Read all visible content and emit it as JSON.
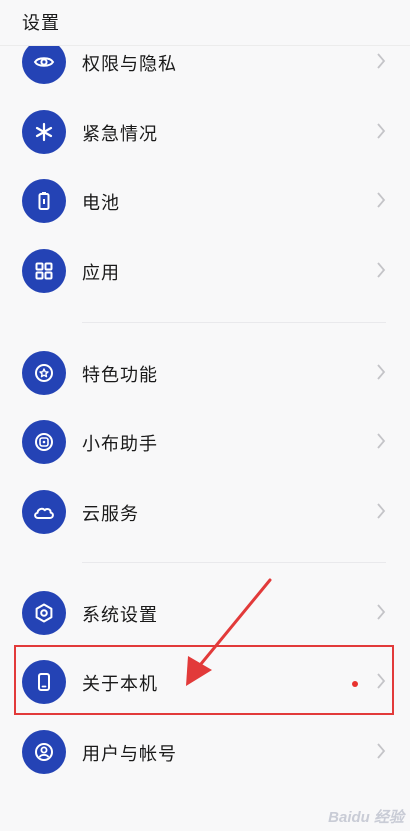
{
  "header": {
    "title": "设置"
  },
  "items": [
    {
      "label": "权限与隐私",
      "icon": "privacy-eye-icon"
    },
    {
      "label": "紧急情况",
      "icon": "emergency-asterisk-icon"
    },
    {
      "label": "电池",
      "icon": "battery-icon"
    },
    {
      "label": "应用",
      "icon": "apps-grid-icon"
    },
    {
      "label": "特色功能",
      "icon": "star-badge-icon"
    },
    {
      "label": "小布助手",
      "icon": "assistant-icon"
    },
    {
      "label": "云服务",
      "icon": "cloud-icon"
    },
    {
      "label": "系统设置",
      "icon": "hexagon-settings-icon"
    },
    {
      "label": "关于本机",
      "icon": "phone-icon",
      "has_update_dot": true
    },
    {
      "label": "用户与帐号",
      "icon": "user-account-icon"
    }
  ],
  "colors": {
    "icon_bg": "#2443b5",
    "highlight": "#e23a3a",
    "update_dot": "#e8322e"
  },
  "watermark": "Baidu 经验"
}
